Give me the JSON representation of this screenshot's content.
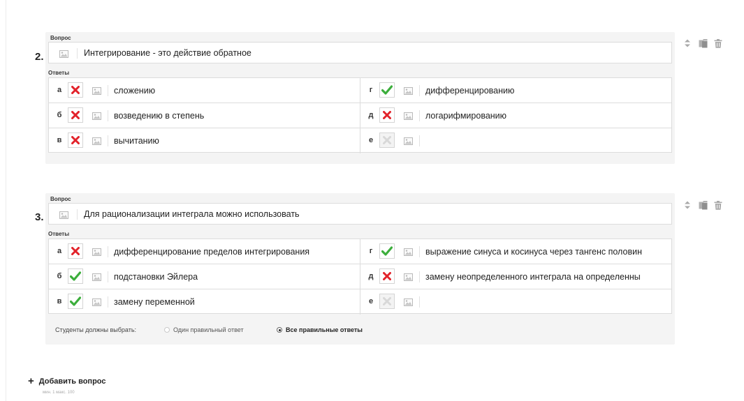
{
  "labels": {
    "question": "Вопрос",
    "answers": "Ответы"
  },
  "questions": [
    {
      "number": "2.",
      "text": "Интегрирование - это действие обратное",
      "answers": [
        {
          "letter": "а",
          "state": "wrong",
          "text": "сложению"
        },
        {
          "letter": "б",
          "state": "wrong",
          "text": "возведению в степень"
        },
        {
          "letter": "в",
          "state": "wrong",
          "text": "вычитанию"
        },
        {
          "letter": "г",
          "state": "correct",
          "text": "дифференцированию"
        },
        {
          "letter": "д",
          "state": "wrong",
          "text": "логарифмированию"
        },
        {
          "letter": "е",
          "state": "empty",
          "text": ""
        }
      ]
    },
    {
      "number": "3.",
      "text": "Для рационализации интеграла можно использовать",
      "answers": [
        {
          "letter": "а",
          "state": "wrong",
          "text": "дифференцирование пределов интегрирования"
        },
        {
          "letter": "б",
          "state": "correct",
          "text": "подстановки Эйлера"
        },
        {
          "letter": "в",
          "state": "correct",
          "text": "замену переменной"
        },
        {
          "letter": "г",
          "state": "correct",
          "text": "выражение синуса и косинуса через тангенс половин"
        },
        {
          "letter": "д",
          "state": "wrong",
          "text": "замену неопределенного интеграла на определенны"
        },
        {
          "letter": "е",
          "state": "empty",
          "text": ""
        }
      ],
      "students": {
        "label": "Студенты должны выбрать:",
        "options": [
          {
            "label": "Один правильный ответ",
            "selected": false
          },
          {
            "label": "Все правильные ответы",
            "selected": true
          }
        ]
      }
    }
  ],
  "add_question": {
    "label": "Добавить вопрос",
    "hint": "мин. 1 макс. 100"
  },
  "icons": {
    "correct": "check-icon",
    "wrong": "cross-icon",
    "empty": "cross-disabled-icon",
    "image": "image-icon",
    "move": "move-icon",
    "copy": "copy-icon",
    "delete": "trash-icon",
    "add": "plus-icon"
  },
  "colors": {
    "correct": "#3cae3c",
    "wrong": "#e2222a",
    "disabled": "#d8d8d8"
  }
}
